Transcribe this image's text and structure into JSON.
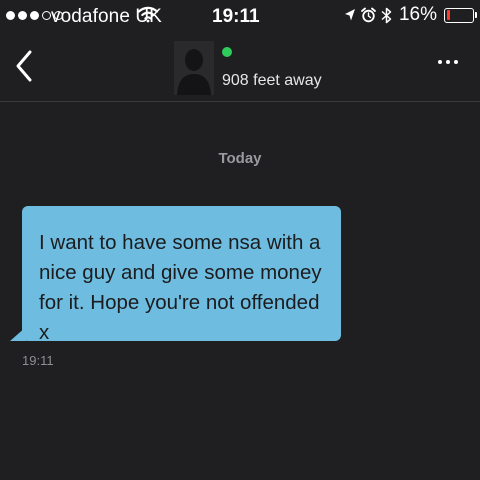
{
  "status_bar": {
    "carrier": "vodafone UK",
    "time": "19:11",
    "battery_percent": "16%",
    "battery_level": 0.16,
    "battery_color": "#ff3b30",
    "signal_bars_filled": 3,
    "signal_bars_total": 5,
    "icons": [
      "signal-dots-icon",
      "wifi-icon",
      "location-arrow-icon",
      "alarm-clock-icon",
      "bluetooth-icon",
      "battery-icon"
    ]
  },
  "header": {
    "back_icon": "chevron-left-icon",
    "distance": "908 feet away",
    "online_color": "#2ecc5a",
    "more_icon": "ellipsis-icon"
  },
  "chat": {
    "day_label": "Today",
    "messages": [
      {
        "text": "I want to have some nsa with a nice guy and give some money for it. Hope you're not offended x",
        "time": "19:11",
        "bubble_color": "#6ebde0"
      }
    ]
  }
}
